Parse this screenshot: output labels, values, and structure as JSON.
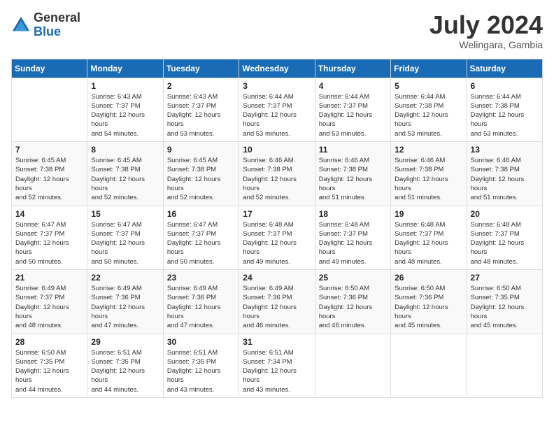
{
  "logo": {
    "general": "General",
    "blue": "Blue"
  },
  "title": "July 2024",
  "subtitle": "Welingara, Gambia",
  "days_of_week": [
    "Sunday",
    "Monday",
    "Tuesday",
    "Wednesday",
    "Thursday",
    "Friday",
    "Saturday"
  ],
  "weeks": [
    [
      {
        "day": "",
        "sunrise": "",
        "sunset": "",
        "daylight": ""
      },
      {
        "day": "1",
        "sunrise": "Sunrise: 6:43 AM",
        "sunset": "Sunset: 7:37 PM",
        "daylight": "Daylight: 12 hours and 54 minutes."
      },
      {
        "day": "2",
        "sunrise": "Sunrise: 6:43 AM",
        "sunset": "Sunset: 7:37 PM",
        "daylight": "Daylight: 12 hours and 53 minutes."
      },
      {
        "day": "3",
        "sunrise": "Sunrise: 6:44 AM",
        "sunset": "Sunset: 7:37 PM",
        "daylight": "Daylight: 12 hours and 53 minutes."
      },
      {
        "day": "4",
        "sunrise": "Sunrise: 6:44 AM",
        "sunset": "Sunset: 7:37 PM",
        "daylight": "Daylight: 12 hours and 53 minutes."
      },
      {
        "day": "5",
        "sunrise": "Sunrise: 6:44 AM",
        "sunset": "Sunset: 7:38 PM",
        "daylight": "Daylight: 12 hours and 53 minutes."
      },
      {
        "day": "6",
        "sunrise": "Sunrise: 6:44 AM",
        "sunset": "Sunset: 7:38 PM",
        "daylight": "Daylight: 12 hours and 53 minutes."
      }
    ],
    [
      {
        "day": "7",
        "sunrise": "Sunrise: 6:45 AM",
        "sunset": "Sunset: 7:38 PM",
        "daylight": "Daylight: 12 hours and 52 minutes."
      },
      {
        "day": "8",
        "sunrise": "Sunrise: 6:45 AM",
        "sunset": "Sunset: 7:38 PM",
        "daylight": "Daylight: 12 hours and 52 minutes."
      },
      {
        "day": "9",
        "sunrise": "Sunrise: 6:45 AM",
        "sunset": "Sunset: 7:38 PM",
        "daylight": "Daylight: 12 hours and 52 minutes."
      },
      {
        "day": "10",
        "sunrise": "Sunrise: 6:46 AM",
        "sunset": "Sunset: 7:38 PM",
        "daylight": "Daylight: 12 hours and 52 minutes."
      },
      {
        "day": "11",
        "sunrise": "Sunrise: 6:46 AM",
        "sunset": "Sunset: 7:38 PM",
        "daylight": "Daylight: 12 hours and 51 minutes."
      },
      {
        "day": "12",
        "sunrise": "Sunrise: 6:46 AM",
        "sunset": "Sunset: 7:38 PM",
        "daylight": "Daylight: 12 hours and 51 minutes."
      },
      {
        "day": "13",
        "sunrise": "Sunrise: 6:46 AM",
        "sunset": "Sunset: 7:38 PM",
        "daylight": "Daylight: 12 hours and 51 minutes."
      }
    ],
    [
      {
        "day": "14",
        "sunrise": "Sunrise: 6:47 AM",
        "sunset": "Sunset: 7:37 PM",
        "daylight": "Daylight: 12 hours and 50 minutes."
      },
      {
        "day": "15",
        "sunrise": "Sunrise: 6:47 AM",
        "sunset": "Sunset: 7:37 PM",
        "daylight": "Daylight: 12 hours and 50 minutes."
      },
      {
        "day": "16",
        "sunrise": "Sunrise: 6:47 AM",
        "sunset": "Sunset: 7:37 PM",
        "daylight": "Daylight: 12 hours and 50 minutes."
      },
      {
        "day": "17",
        "sunrise": "Sunrise: 6:48 AM",
        "sunset": "Sunset: 7:37 PM",
        "daylight": "Daylight: 12 hours and 49 minutes."
      },
      {
        "day": "18",
        "sunrise": "Sunrise: 6:48 AM",
        "sunset": "Sunset: 7:37 PM",
        "daylight": "Daylight: 12 hours and 49 minutes."
      },
      {
        "day": "19",
        "sunrise": "Sunrise: 6:48 AM",
        "sunset": "Sunset: 7:37 PM",
        "daylight": "Daylight: 12 hours and 48 minutes."
      },
      {
        "day": "20",
        "sunrise": "Sunrise: 6:48 AM",
        "sunset": "Sunset: 7:37 PM",
        "daylight": "Daylight: 12 hours and 48 minutes."
      }
    ],
    [
      {
        "day": "21",
        "sunrise": "Sunrise: 6:49 AM",
        "sunset": "Sunset: 7:37 PM",
        "daylight": "Daylight: 12 hours and 48 minutes."
      },
      {
        "day": "22",
        "sunrise": "Sunrise: 6:49 AM",
        "sunset": "Sunset: 7:36 PM",
        "daylight": "Daylight: 12 hours and 47 minutes."
      },
      {
        "day": "23",
        "sunrise": "Sunrise: 6:49 AM",
        "sunset": "Sunset: 7:36 PM",
        "daylight": "Daylight: 12 hours and 47 minutes."
      },
      {
        "day": "24",
        "sunrise": "Sunrise: 6:49 AM",
        "sunset": "Sunset: 7:36 PM",
        "daylight": "Daylight: 12 hours and 46 minutes."
      },
      {
        "day": "25",
        "sunrise": "Sunrise: 6:50 AM",
        "sunset": "Sunset: 7:36 PM",
        "daylight": "Daylight: 12 hours and 46 minutes."
      },
      {
        "day": "26",
        "sunrise": "Sunrise: 6:50 AM",
        "sunset": "Sunset: 7:36 PM",
        "daylight": "Daylight: 12 hours and 45 minutes."
      },
      {
        "day": "27",
        "sunrise": "Sunrise: 6:50 AM",
        "sunset": "Sunset: 7:35 PM",
        "daylight": "Daylight: 12 hours and 45 minutes."
      }
    ],
    [
      {
        "day": "28",
        "sunrise": "Sunrise: 6:50 AM",
        "sunset": "Sunset: 7:35 PM",
        "daylight": "Daylight: 12 hours and 44 minutes."
      },
      {
        "day": "29",
        "sunrise": "Sunrise: 6:51 AM",
        "sunset": "Sunset: 7:35 PM",
        "daylight": "Daylight: 12 hours and 44 minutes."
      },
      {
        "day": "30",
        "sunrise": "Sunrise: 6:51 AM",
        "sunset": "Sunset: 7:35 PM",
        "daylight": "Daylight: 12 hours and 43 minutes."
      },
      {
        "day": "31",
        "sunrise": "Sunrise: 6:51 AM",
        "sunset": "Sunset: 7:34 PM",
        "daylight": "Daylight: 12 hours and 43 minutes."
      },
      {
        "day": "",
        "sunrise": "",
        "sunset": "",
        "daylight": ""
      },
      {
        "day": "",
        "sunrise": "",
        "sunset": "",
        "daylight": ""
      },
      {
        "day": "",
        "sunrise": "",
        "sunset": "",
        "daylight": ""
      }
    ]
  ]
}
